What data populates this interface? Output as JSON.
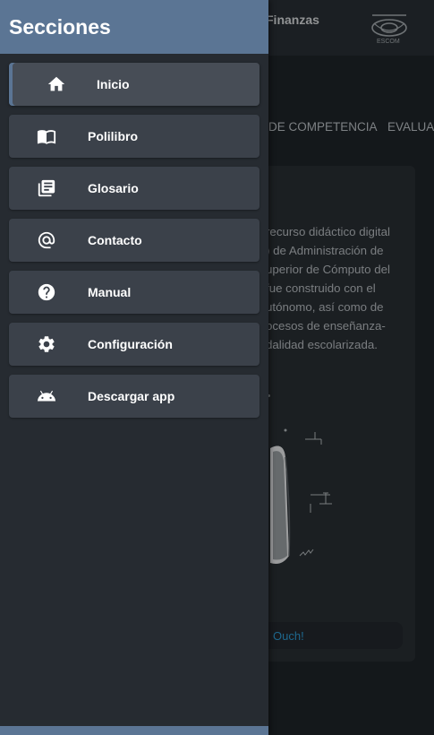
{
  "background": {
    "title": "Finanzas",
    "logo_text": "ESCOM",
    "tabs": [
      "DE COMPETENCIA",
      "EVALUAC"
    ],
    "paragraph_lines": [
      "recurso didáctico digital",
      ") de Administración de",
      "uperior de Cómputo del",
      "fue construido con el",
      "utónomo, así como de",
      "ocesos de enseñanza-",
      "dalidad escolarizada."
    ],
    "ouch_label": "Ouch!"
  },
  "drawer": {
    "title": "Secciones",
    "items": [
      {
        "label": "Inicio",
        "icon": "home-icon",
        "active": true
      },
      {
        "label": "Polilibro",
        "icon": "book-icon",
        "active": false
      },
      {
        "label": "Glosario",
        "icon": "library-books-icon",
        "active": false
      },
      {
        "label": "Contacto",
        "icon": "at-sign-icon",
        "active": false
      },
      {
        "label": "Manual",
        "icon": "help-circle-icon",
        "active": false
      },
      {
        "label": "Configuración",
        "icon": "gear-icon",
        "active": false
      },
      {
        "label": "Descargar app",
        "icon": "android-icon",
        "active": false
      }
    ]
  },
  "colors": {
    "drawer_header": "#5b7594",
    "drawer_bg": "#262b31",
    "menu_item": "#3b414a",
    "link": "#2a8fc4"
  }
}
